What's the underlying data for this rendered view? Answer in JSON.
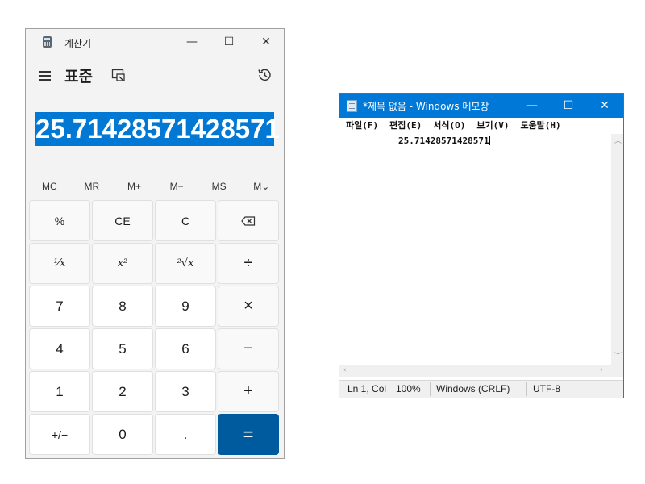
{
  "calculator": {
    "title": "계산기",
    "mode": "표준",
    "display_value": "25.71428571428571",
    "window_controls": {
      "minimize": "—",
      "maximize": "☐",
      "close": "✕"
    },
    "memory_buttons": [
      "MC",
      "MR",
      "M+",
      "M−",
      "MS",
      "M⌄"
    ],
    "keys": {
      "percent": "%",
      "clear_entry": "CE",
      "clear": "C",
      "backspace": "⌫",
      "reciprocal": "⅟x",
      "square": "x²",
      "sqrt": "²√x",
      "divide": "÷",
      "seven": "7",
      "eight": "8",
      "nine": "9",
      "multiply": "×",
      "four": "4",
      "five": "5",
      "six": "6",
      "subtract": "−",
      "one": "1",
      "two": "2",
      "three": "3",
      "add": "+",
      "negate": "+/−",
      "zero": "0",
      "decimal": ".",
      "equals": "="
    }
  },
  "notepad": {
    "title": "*제목 없음 - Windows 메모장",
    "window_controls": {
      "minimize": "—",
      "maximize": "☐",
      "close": "✕"
    },
    "menu": {
      "file": "파일(F)",
      "edit": "편집(E)",
      "format": "서식(O)",
      "view": "보기(V)",
      "help": "도움말(H)"
    },
    "content": "25.71428571428571",
    "status": {
      "position": "Ln 1, Col",
      "zoom": "100%",
      "line_ending": "Windows (CRLF)",
      "encoding": "UTF-8"
    }
  },
  "colors": {
    "accent": "#0078d4",
    "equals_key": "#005a9e",
    "notepad_titlebar": "#0078d7",
    "calculator_background": "#f3f3f3"
  },
  "icons": [
    "calculator-app-icon",
    "hamburger-menu-icon",
    "keep-on-top-icon",
    "history-icon",
    "notepad-app-icon"
  ]
}
